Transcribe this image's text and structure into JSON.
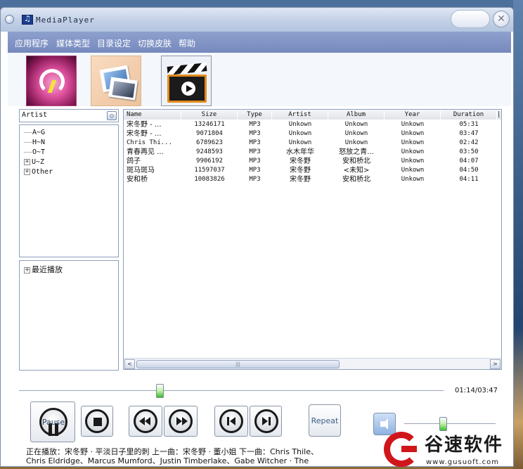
{
  "window": {
    "title": "MediaPlayer"
  },
  "menu": [
    "应用程序",
    "媒体类型",
    "目录设定",
    "切换皮肤",
    "帮助"
  ],
  "toolbar": {
    "icons": [
      "artist-icon",
      "album-icon",
      "video-icon"
    ]
  },
  "filter": {
    "selected": "Artist"
  },
  "tree": [
    "A~G",
    "H~N",
    "O~T",
    "U~Z",
    "Other"
  ],
  "tree2": [
    "最近播放"
  ],
  "playlist": {
    "columns": [
      "Name",
      "Size",
      "Type",
      "Artist",
      "Album",
      "Year",
      "Duration"
    ],
    "rows": [
      [
        "宋冬野 - ...",
        "13246171",
        "MP3",
        "Unkown",
        "Unkown",
        "Unkown",
        "05:31"
      ],
      [
        "宋冬野 - ...",
        "9071804",
        "MP3",
        "Unkown",
        "Unkown",
        "Unkown",
        "03:47"
      ],
      [
        "Chris Thi...",
        "6789623",
        "MP3",
        "Unkown",
        "Unkown",
        "Unkown",
        "02:42"
      ],
      [
        "青春再见 ...",
        "9248593",
        "MP3",
        "水木年华",
        "怒放之青...",
        "Unkown",
        "03:50"
      ],
      [
        "鸽子",
        "9906192",
        "MP3",
        "宋冬野",
        "安和桥北",
        "Unkown",
        "04:07"
      ],
      [
        "斑马斑马",
        "11597037",
        "MP3",
        "宋冬野",
        "<未知>",
        "Unkown",
        "04:50"
      ],
      [
        "安和桥",
        "10083826",
        "MP3",
        "宋冬野",
        "安和桥北",
        "Unkown",
        "04:11"
      ]
    ]
  },
  "scrollbar": {
    "left_arrow": "<",
    "right_arrow": ">",
    "grip": "|||"
  },
  "seek": {
    "position": 0.331,
    "time": "01:14/03:47"
  },
  "controls": {
    "pause_label": "Pause",
    "repeat_label": "Repeat"
  },
  "volume": {
    "level": 0.42
  },
  "status": {
    "now_playing": "正在播放：宋冬野 · 平淡日子里的刺  上一曲：宋冬野 · 董小姐  下一曲：Chris Thile、Chris Eldridge、Marcus Mumford、Justin Timberlake、Gabe Witcher · The Auld"
  },
  "watermark": {
    "name": "谷速软件",
    "url": "www.gusuoft.com"
  },
  "colors": {
    "menubar": "#7f92c4",
    "accent_green": "#3cbc2a",
    "watermark_red": "#d0161b"
  }
}
